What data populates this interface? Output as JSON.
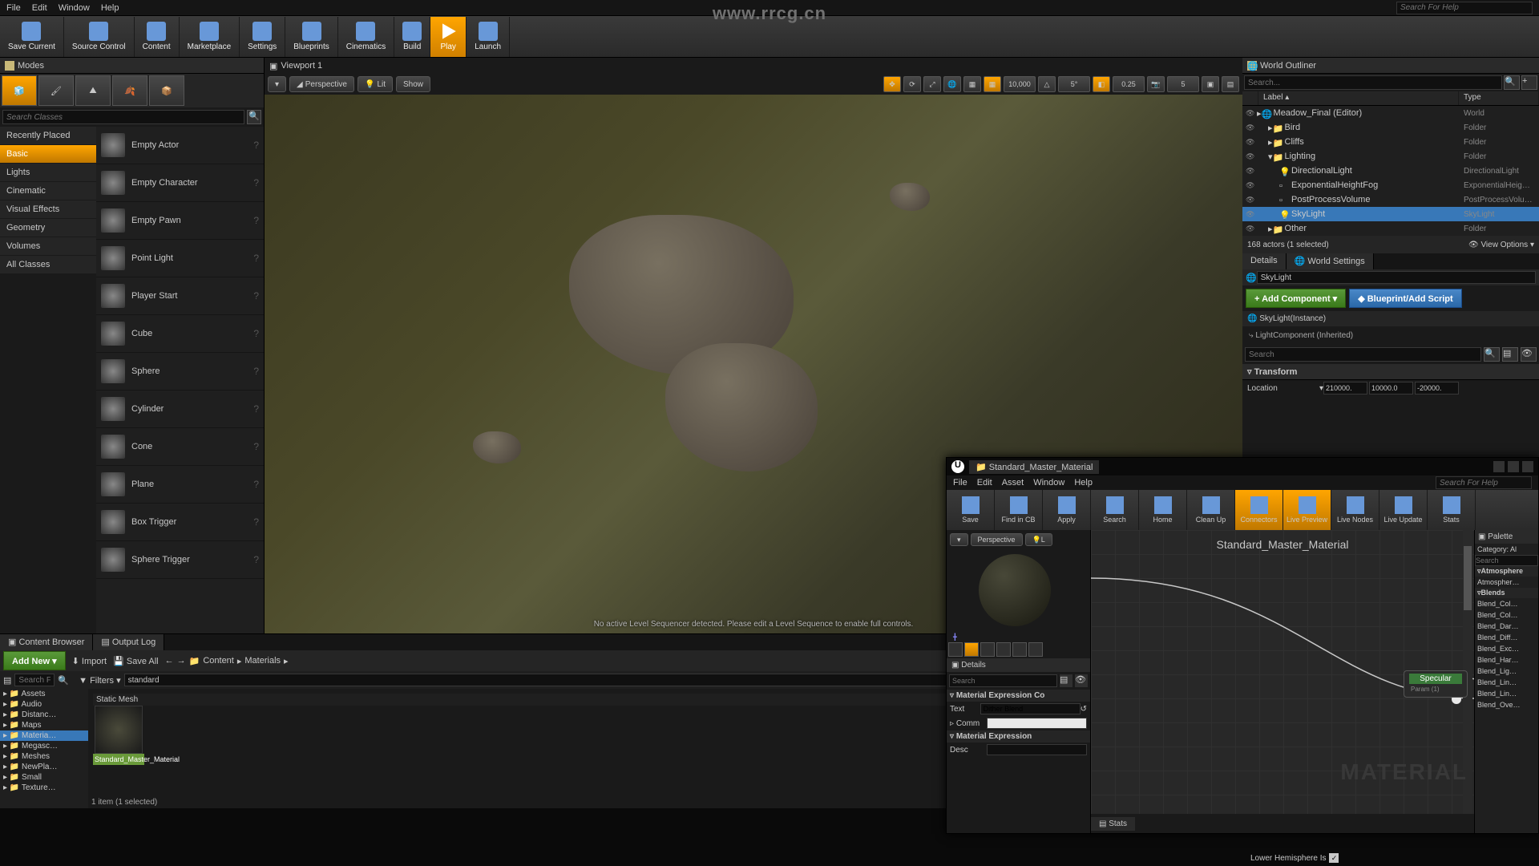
{
  "watermark_url": "www.rrcg.cn",
  "menubar": {
    "file": "File",
    "edit": "Edit",
    "window": "Window",
    "help": "Help",
    "search_placeholder": "Search For Help"
  },
  "toolbar": {
    "save_current": "Save Current",
    "source_control": "Source Control",
    "content": "Content",
    "marketplace": "Marketplace",
    "settings": "Settings",
    "blueprints": "Blueprints",
    "cinematics": "Cinematics",
    "build": "Build",
    "play": "Play",
    "launch": "Launch"
  },
  "modes": {
    "tab": "Modes",
    "search_placeholder": "Search Classes",
    "categories": [
      "Recently Placed",
      "Basic",
      "Lights",
      "Cinematic",
      "Visual Effects",
      "Geometry",
      "Volumes",
      "All Classes"
    ],
    "active_category_index": 1,
    "items": [
      "Empty Actor",
      "Empty Character",
      "Empty Pawn",
      "Point Light",
      "Player Start",
      "Cube",
      "Sphere",
      "Cylinder",
      "Cone",
      "Plane",
      "Box Trigger",
      "Sphere Trigger"
    ]
  },
  "viewport": {
    "tab": "Viewport 1",
    "perspective": "Perspective",
    "lit": "Lit",
    "show": "Show",
    "snap_translate": "10,000",
    "snap_rotate": "5°",
    "snap_scale": "0.25",
    "cam_speed": "5",
    "status": "No active Level Sequencer detected. Please edit a Level Sequence to enable full controls."
  },
  "outliner": {
    "title": "World Outliner",
    "search_placeholder": "Search...",
    "col_label": "Label",
    "col_type": "Type",
    "tree": [
      {
        "lbl": "Meadow_Final (Editor)",
        "type": "World",
        "ind": 0,
        "icon": "world"
      },
      {
        "lbl": "Bird",
        "type": "Folder",
        "ind": 1,
        "icon": "folder"
      },
      {
        "lbl": "Cliffs",
        "type": "Folder",
        "ind": 1,
        "icon": "folder"
      },
      {
        "lbl": "Lighting",
        "type": "Folder",
        "ind": 1,
        "icon": "folder",
        "open": true
      },
      {
        "lbl": "DirectionalLight",
        "type": "DirectionalLight",
        "ind": 2,
        "icon": "light"
      },
      {
        "lbl": "ExponentialHeightFog",
        "type": "ExponentialHeig…",
        "ind": 2,
        "icon": "fog"
      },
      {
        "lbl": "PostProcessVolume",
        "type": "PostProcessVolu…",
        "ind": 2,
        "icon": "vol"
      },
      {
        "lbl": "SkyLight",
        "type": "SkyLight",
        "ind": 2,
        "icon": "light",
        "sel": true
      },
      {
        "lbl": "Other",
        "type": "Folder",
        "ind": 1,
        "icon": "folder"
      }
    ],
    "footer": "168 actors (1 selected)",
    "view_options": "View Options"
  },
  "details": {
    "tab_details": "Details",
    "tab_world": "World Settings",
    "actor_name": "SkyLight",
    "add_component": "+ Add Component",
    "blueprint_btn": "Blueprint/Add Script",
    "instance": "SkyLight(Instance)",
    "inherited": "LightComponent (Inherited)",
    "search_placeholder": "Search",
    "transform": "Transform",
    "location": "Location",
    "loc_x": "210000.",
    "loc_y": "10000.0",
    "loc_z": "-20000."
  },
  "content_browser": {
    "tab_cb": "Content Browser",
    "tab_log": "Output Log",
    "add_new": "Add New",
    "import": "Import",
    "save_all": "Save All",
    "path_root": "Content",
    "path_sub": "Materials",
    "filters": "Filters",
    "search_value": "standard",
    "search_folders_placeholder": "Search F",
    "tree": [
      "Assets",
      "Audio",
      "Distanc…",
      "Maps",
      "Materia…",
      "Megasc…",
      "Meshes",
      "NewPla…",
      "Small",
      "Texture…"
    ],
    "tree_sel_index": 4,
    "header": "Static Mesh",
    "asset_name": "Standard_Master_Material",
    "footer": "1 item (1 selected)"
  },
  "material_editor": {
    "window_title": "Standard_Master_Material",
    "menu": {
      "file": "File",
      "edit": "Edit",
      "asset": "Asset",
      "window": "Window",
      "help": "Help",
      "search_placeholder": "Search For Help"
    },
    "toolbar": {
      "save": "Save",
      "find": "Find in CB",
      "apply": "Apply",
      "search": "Search",
      "home": "Home",
      "cleanup": "Clean Up",
      "connectors": "Connectors",
      "live_preview": "Live Preview",
      "live_nodes": "Live Nodes",
      "live_update": "Live Update",
      "stats": "Stats"
    },
    "preview": {
      "perspective": "Perspective",
      "lit_abbrev": "L"
    },
    "details_panel": {
      "title": "Details",
      "search_placeholder": "Search",
      "sect1": "Material Expression Co",
      "text_label": "Text",
      "text_value": "Dither Blend",
      "comm_label": "Comm",
      "sect2": "Material Expression",
      "desc_label": "Desc"
    },
    "graph": {
      "title": "Standard_Master_Material",
      "watermark": "MATERIAL",
      "node_specular": "Specular",
      "node_param": "Param (1)",
      "stats_tab": "Stats"
    },
    "palette": {
      "title": "Palette",
      "category_label": "Category:",
      "category_value": "Al",
      "search_placeholder": "Search",
      "groups": [
        {
          "name": "Atmosphere",
          "items": [
            "Atmospher…"
          ]
        },
        {
          "name": "Blends",
          "items": [
            "Blend_Col…",
            "Blend_Col…",
            "Blend_Dar…",
            "Blend_Diff…",
            "Blend_Exc…",
            "Blend_Har…",
            "Blend_Lig…",
            "Blend_Lin…",
            "Blend_Lin…",
            "Blend_Ove…"
          ]
        }
      ]
    }
  },
  "lower_hemisphere": "Lower Hemisphere Is"
}
